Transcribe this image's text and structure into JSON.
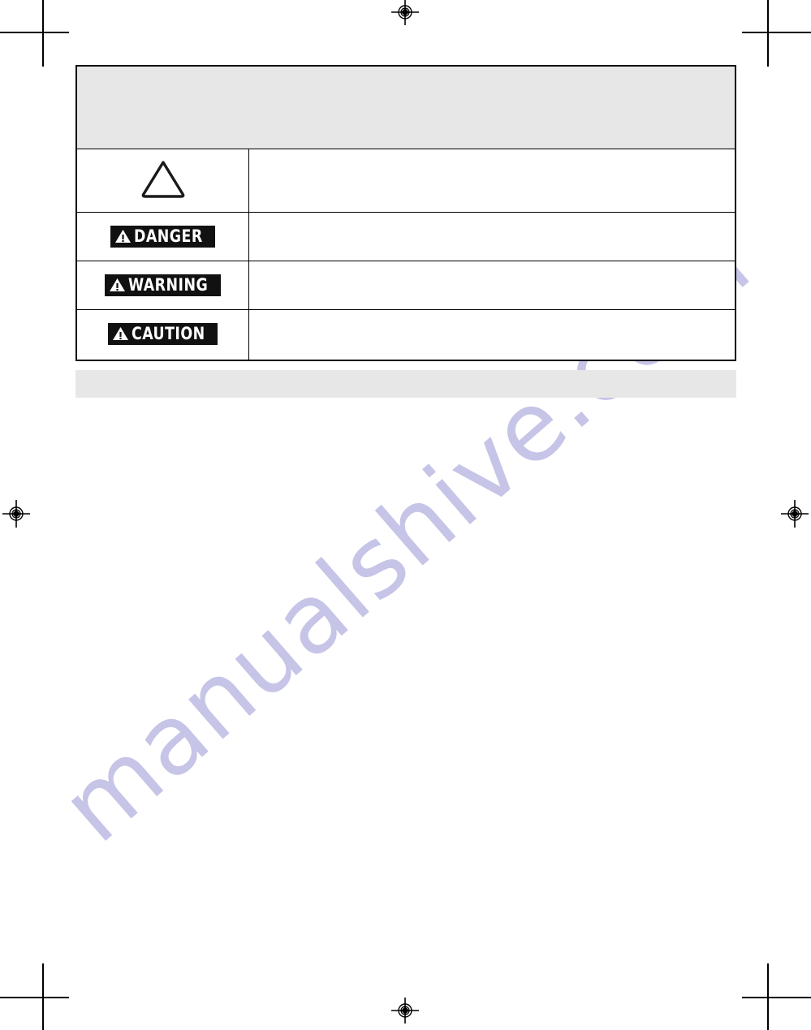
{
  "page": {
    "background_color": "#ffffff",
    "band_color": "#e7e7e7",
    "rule_color": "#000000"
  },
  "watermark": {
    "text": "manualshive.com",
    "color": "#c4c1e6"
  },
  "printers_marks": {
    "registration_mark_name": "registration-target",
    "crop_mark_name": "crop-mark",
    "count": 4
  },
  "symbols_table": {
    "header": {
      "text": ""
    },
    "columns": {
      "symbol_header": "",
      "description_header": ""
    },
    "rows": [
      {
        "id": "safety-alert-symbol",
        "symbol_kind": "triangle-outline",
        "label": "",
        "description": ""
      },
      {
        "id": "danger",
        "symbol_kind": "signal-badge",
        "label": "DANGER",
        "description": ""
      },
      {
        "id": "warning",
        "symbol_kind": "signal-badge",
        "label": "WARNING",
        "description": ""
      },
      {
        "id": "caution",
        "symbol_kind": "signal-badge",
        "label": "CAUTION",
        "description": ""
      }
    ],
    "badge": {
      "background_color": "#111111",
      "text_color": "#ffffff"
    }
  },
  "section_band": {
    "title": ""
  },
  "body": {
    "text": ""
  }
}
